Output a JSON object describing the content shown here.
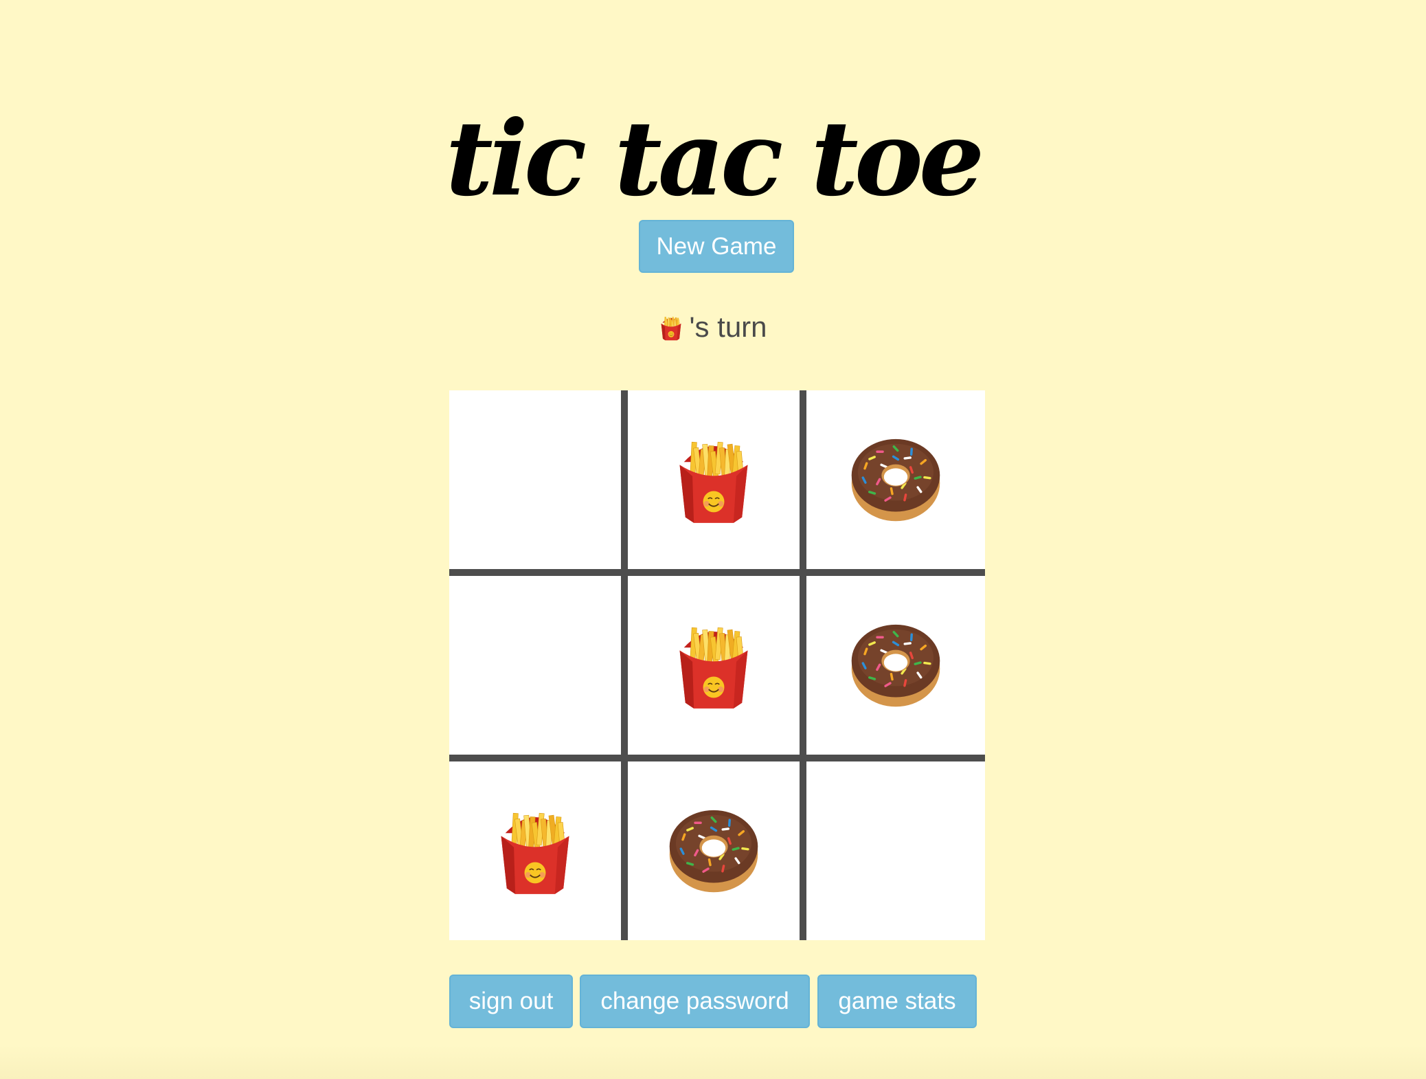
{
  "header": {
    "title": "tic tac toe"
  },
  "controls": {
    "new_game_label": "New Game"
  },
  "status": {
    "current_player_icon": "fries-icon",
    "turn_suffix": "'s turn"
  },
  "board": {
    "players": {
      "x": "fries",
      "o": "donut"
    },
    "cells": [
      [
        "",
        "fries",
        "donut"
      ],
      [
        "",
        "fries",
        "donut"
      ],
      [
        "fries",
        "donut",
        ""
      ]
    ]
  },
  "footer": {
    "sign_out_label": "sign out",
    "change_password_label": "change password",
    "game_stats_label": "game stats"
  },
  "colors": {
    "background": "#fff8c6",
    "button": "#73bcdb",
    "grid_line": "#4d4d4d",
    "text": "#4a4a4a"
  }
}
